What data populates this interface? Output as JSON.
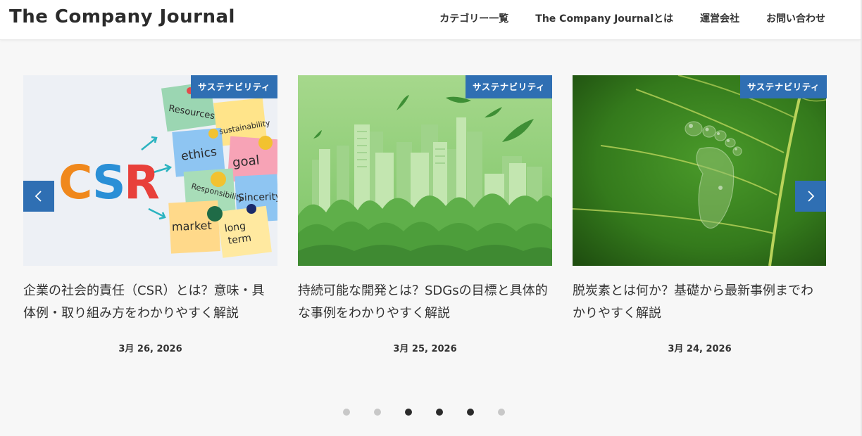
{
  "site": {
    "title": "The Company Journal"
  },
  "nav": {
    "items": [
      {
        "label": "カテゴリー一覧"
      },
      {
        "label": "The Company Journalとは"
      },
      {
        "label": "運営会社"
      },
      {
        "label": "お問い合わせ"
      }
    ]
  },
  "carousel": {
    "prev_icon": "chevron-left-icon",
    "next_icon": "chevron-right-icon",
    "cards": [
      {
        "category": "サステナビリティ",
        "title": "企業の社会的責任（CSR）とは？意味・具体例・取り組み方をわかりやすく解説",
        "date": "3月 26, 2026",
        "image_words": {
          "big": "CSR",
          "notes": [
            "Resources",
            "sustainability",
            "ethics",
            "goal",
            "Responsibility",
            "Sincerity",
            "market",
            "long term"
          ]
        }
      },
      {
        "category": "サステナビリティ",
        "title": "持続可能な開発とは？SDGsの目標と具体的な事例をわかりやすく解説",
        "date": "3月 25, 2026"
      },
      {
        "category": "サステナビリティ",
        "title": "脱炭素とは何か？基礎から最新事例までわかりやすく解説",
        "date": "3月 24, 2026"
      }
    ],
    "pagination": {
      "count": 6,
      "active": [
        2,
        3,
        4
      ]
    }
  },
  "colors": {
    "accent": "#2f6fb3",
    "dot_active": "#2b2b2b",
    "dot_inactive": "#c8c8c8"
  }
}
